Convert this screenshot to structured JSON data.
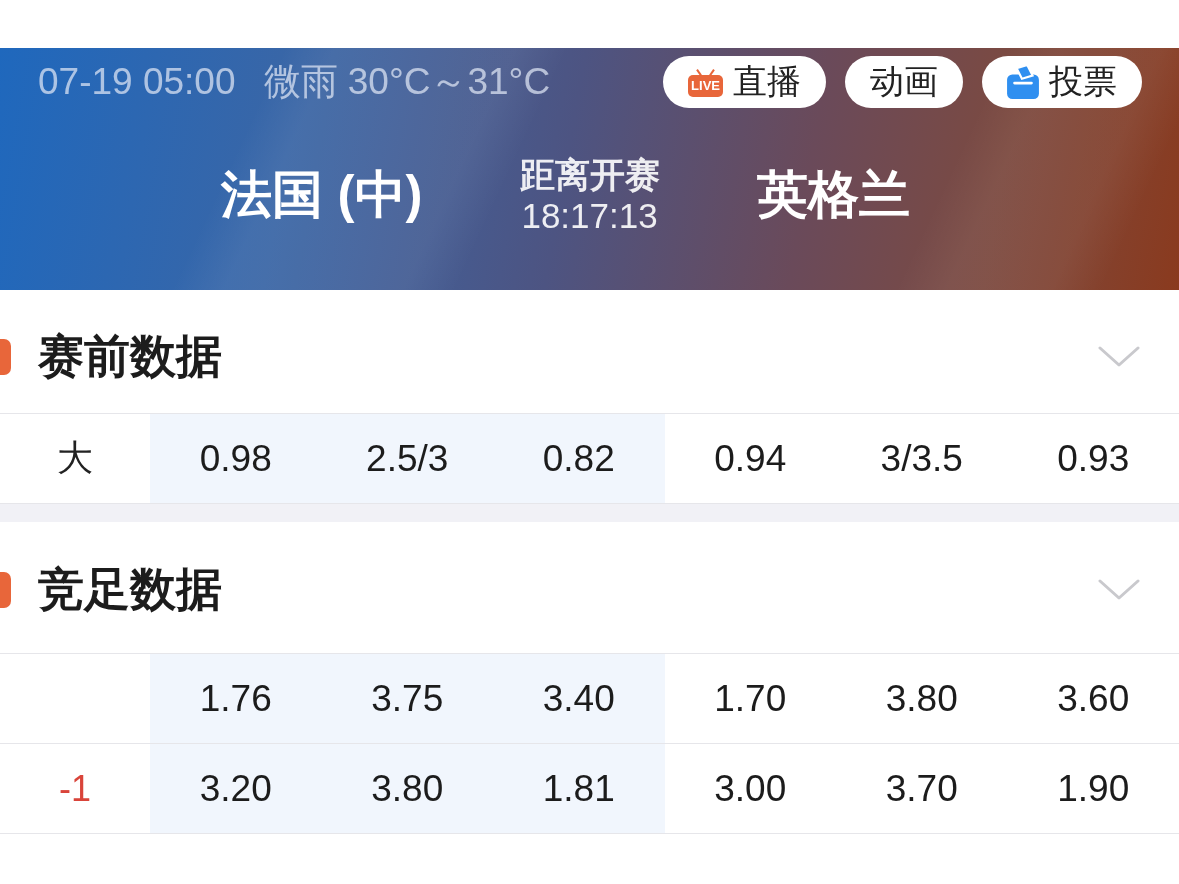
{
  "header": {
    "datetime": "07-19 05:00",
    "weather": "微雨 30°C～31°C",
    "buttons": [
      {
        "label": "直播",
        "kind": "live",
        "badge": "LIVE"
      },
      {
        "label": "动画",
        "kind": "plain"
      },
      {
        "label": "投票",
        "kind": "vote"
      }
    ],
    "home_team": "法国 (中)",
    "countdown": {
      "label": "距离开赛",
      "time": "18:17:13"
    },
    "away_team": "英格兰"
  },
  "sections": [
    {
      "title": "赛前数据",
      "rows": [
        {
          "kind": "total",
          "label": "大",
          "cells": [
            {
              "text": "0.98",
              "shaded": true
            },
            {
              "text": "2.5/3",
              "shaded": true
            },
            {
              "text": "0.82",
              "shaded": true
            },
            {
              "text": "0.94",
              "shaded": false
            },
            {
              "text": "3/3.5",
              "shaded": false
            },
            {
              "text": "0.93",
              "shaded": false
            }
          ]
        }
      ]
    },
    {
      "title": "竞足数据",
      "rows": [
        {
          "kind": "plain",
          "cells": [
            {
              "text": "1.76",
              "shaded": true
            },
            {
              "text": "3.75",
              "shaded": true
            },
            {
              "text": "3.40",
              "shaded": true
            },
            {
              "text": "1.70",
              "shaded": false
            },
            {
              "text": "3.80",
              "shaded": false
            },
            {
              "text": "3.60",
              "shaded": false
            }
          ]
        },
        {
          "kind": "handicap",
          "label": "-1",
          "cells": [
            {
              "text": "3.20",
              "shaded": true
            },
            {
              "text": "3.80",
              "shaded": true
            },
            {
              "text": "1.81",
              "shaded": true
            },
            {
              "text": "3.00",
              "shaded": false
            },
            {
              "text": "3.70",
              "shaded": false
            },
            {
              "text": "1.90",
              "shaded": false
            }
          ]
        }
      ]
    }
  ]
}
